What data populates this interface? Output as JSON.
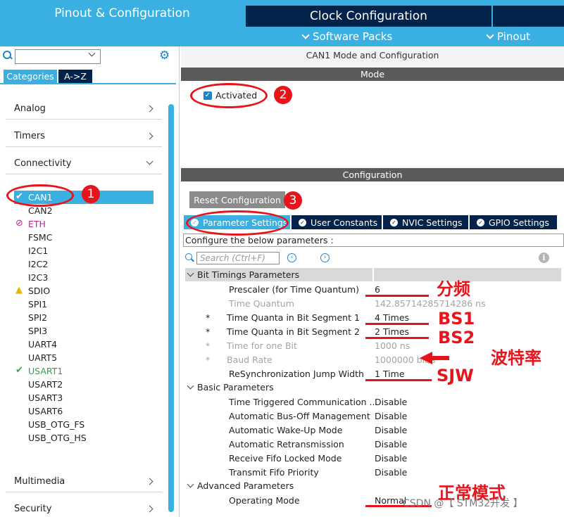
{
  "tabs": {
    "pinout_config": "Pinout & Configuration",
    "clock_config": "Clock Configuration",
    "software_packs": "Software Packs",
    "pinout": "Pinout"
  },
  "left_panel": {
    "categories_label": "Categories",
    "az_label": "A->Z",
    "categories": {
      "analog": "Analog",
      "timers": "Timers",
      "connectivity": "Connectivity",
      "multimedia": "Multimedia",
      "security": "Security"
    },
    "peripherals": [
      {
        "name": "CAN1",
        "status": "ok"
      },
      {
        "name": "CAN2",
        "status": "none"
      },
      {
        "name": "ETH",
        "status": "blocked"
      },
      {
        "name": "FSMC",
        "status": "none"
      },
      {
        "name": "I2C1",
        "status": "none"
      },
      {
        "name": "I2C2",
        "status": "none"
      },
      {
        "name": "I2C3",
        "status": "none"
      },
      {
        "name": "SDIO",
        "status": "warning"
      },
      {
        "name": "SPI1",
        "status": "none"
      },
      {
        "name": "SPI2",
        "status": "none"
      },
      {
        "name": "SPI3",
        "status": "none"
      },
      {
        "name": "UART4",
        "status": "none"
      },
      {
        "name": "UART5",
        "status": "none"
      },
      {
        "name": "USART1",
        "status": "ok"
      },
      {
        "name": "USART2",
        "status": "none"
      },
      {
        "name": "USART3",
        "status": "none"
      },
      {
        "name": "USART6",
        "status": "none"
      },
      {
        "name": "USB_OTG_FS",
        "status": "none"
      },
      {
        "name": "USB_OTG_HS",
        "status": "none"
      }
    ]
  },
  "right_panel": {
    "title": "CAN1 Mode and Configuration",
    "mode_header": "Mode",
    "activated_label": "Activated",
    "activated": true,
    "config_header": "Configuration",
    "reset_label": "Reset Configuration",
    "tabs": [
      "Parameter Settings",
      "User Constants",
      "NVIC Settings",
      "GPIO Settings"
    ],
    "hint": "Configure the below parameters :",
    "search_placeholder": "Search (Ctrl+F)",
    "groups": {
      "bit_timing": "Bit Timings Parameters",
      "basic": "Basic Parameters",
      "advanced": "Advanced Parameters"
    },
    "bit_timing_params": [
      {
        "name": "Prescaler (for Time Quantum)",
        "value": "6",
        "star": "",
        "dim": false
      },
      {
        "name": "Time Quantum",
        "value": "142.85714285714286 ns",
        "star": "",
        "dim": true
      },
      {
        "name": "Time Quanta in Bit Segment 1",
        "value": "4 Times",
        "star": "*",
        "dim": false
      },
      {
        "name": "Time Quanta in Bit Segment 2",
        "value": "2 Times",
        "star": "*",
        "dim": false
      },
      {
        "name": "Time for one Bit",
        "value": "1000 ns",
        "star": "*",
        "dim": true
      },
      {
        "name": "Baud Rate",
        "value": "1000000 bit/s",
        "star": "*",
        "dim": true
      },
      {
        "name": "ReSynchronization Jump Width",
        "value": "1 Time",
        "star": "",
        "dim": false
      }
    ],
    "basic_params": [
      {
        "name": "Time Triggered Communication ...",
        "value": "Disable"
      },
      {
        "name": "Automatic Bus-Off Management",
        "value": "Disable"
      },
      {
        "name": "Automatic Wake-Up Mode",
        "value": "Disable"
      },
      {
        "name": "Automatic Retransmission",
        "value": "Disable"
      },
      {
        "name": "Receive Fifo Locked Mode",
        "value": "Disable"
      },
      {
        "name": "Transmit Fifo Priority",
        "value": "Disable"
      }
    ],
    "advanced_params": [
      {
        "name": "Operating Mode",
        "value": "Normal"
      }
    ]
  },
  "annotations": {
    "n1": "1",
    "n2": "2",
    "n3": "3",
    "prescaler": "分频",
    "bs1": "BS1",
    "bs2": "BS2",
    "baud": "波特率",
    "sjw": "SJW",
    "normal_mode": "正常模式",
    "watermark": "CSDN @【 STM32开发 】",
    "color": "#e8141b"
  }
}
